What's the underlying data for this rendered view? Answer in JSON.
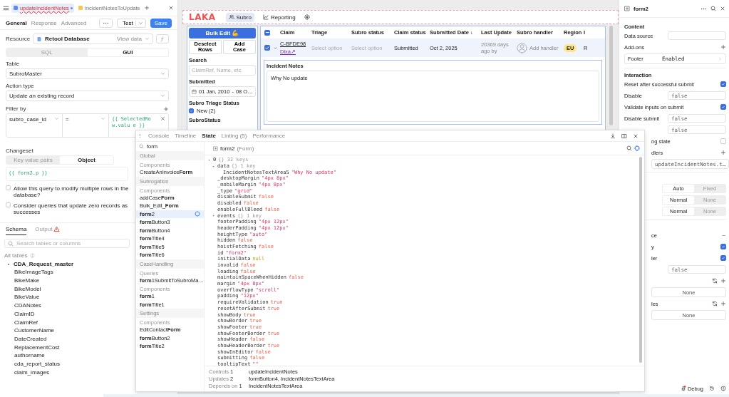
{
  "editor_tabs": [
    {
      "label": "updateIncidentNotes",
      "selected": true,
      "error": true,
      "unsaved": true
    },
    {
      "label": "IncidentNotesToUpdate",
      "selected": false,
      "error": false,
      "unsaved": false
    }
  ],
  "query_tabs": [
    {
      "label": "General",
      "selected": true
    },
    {
      "label": "Response",
      "selected": false
    },
    {
      "label": "Advanced",
      "selected": false
    }
  ],
  "test_button": "Test",
  "save_button": "Save",
  "resource": {
    "label": "Resource",
    "value": "Retool Database",
    "action": "View data"
  },
  "mode_toggle": [
    {
      "label": "SQL",
      "selected": false
    },
    {
      "label": "GUI",
      "selected": true
    }
  ],
  "table_select": {
    "label": "Table",
    "value": "SubroMaster"
  },
  "action_type": {
    "label": "Action type",
    "value": "Update an existing record"
  },
  "filter": {
    "label": "Filter by",
    "column": "subro_case_id",
    "operator": "=",
    "value": "{{ SelectedRow.valu e }}"
  },
  "changeset": {
    "label": "Changeset",
    "modes": [
      {
        "label": "Key value pairs",
        "selected": false
      },
      {
        "label": "Object",
        "selected": true
      }
    ],
    "code": "{{ form2.p }}"
  },
  "options": [
    {
      "label": "Allow this query to modify multiple rows in the database?",
      "checked": false
    },
    {
      "label": "Consider queries that update zero records as successes",
      "checked": false
    }
  ],
  "schema": {
    "tabs": [
      {
        "label": "Schema",
        "selected": true,
        "warning": false
      },
      {
        "label": "Output",
        "selected": false,
        "warning": true
      }
    ],
    "search_placeholder": "Search tables or columns",
    "all_tables": "All tables",
    "tree": [
      {
        "name": "CDA_Request_master",
        "expanded": true,
        "children": [
          {
            "name": "BikeImageTags"
          },
          {
            "name": "BikeMake"
          },
          {
            "name": "BikeModel"
          },
          {
            "name": "BikeValue"
          },
          {
            "name": "CDANotes"
          },
          {
            "name": "ClaimID"
          },
          {
            "name": "ClaimRef"
          },
          {
            "name": "CustomerName"
          },
          {
            "name": "DateCreated"
          },
          {
            "name": "ReplacementCost"
          },
          {
            "name": "authorname"
          },
          {
            "name": "cda_report_status"
          },
          {
            "name": "claim_images"
          }
        ]
      }
    ]
  },
  "app": {
    "logo": "LAKA",
    "nav": [
      {
        "label": "Subro",
        "selected": true
      },
      {
        "label": "Reporting",
        "selected": false
      }
    ],
    "filters": {
      "bulk_edit": "Bulk Edit 💪",
      "deselect": "Deselect Rows",
      "add_case": "Add Case",
      "search_label": "Search",
      "search_placeholder": "ClaimRef, Name, etc.",
      "submitted_label": "Submitted",
      "date_from": "01 Jan, 2010",
      "date_sep": "-",
      "date_to": "08 O…",
      "triage_label": "Subro Triage Status",
      "triage_options": [
        {
          "label": "New (2)",
          "checked": true
        }
      ],
      "status_label": "SubroStatus"
    },
    "grid": {
      "partial_selection": true,
      "columns": [
        "Claim",
        "Triage",
        "Subro status",
        "Claim status",
        "Submitted Date ↓",
        "Last Update",
        "Subro handler",
        "Region",
        "I"
      ],
      "rows": [
        {
          "selected": true,
          "expanded": true,
          "claim": "C-BFDE98",
          "link": "Dixa↗",
          "triage": "Select option",
          "subro_status": "Select option",
          "claim_status": "Submitted",
          "submitted_date": "Oct 2, 2025",
          "last_update": "20369 days ago by",
          "handler": "Add handler",
          "region": "EU",
          "column_9": "R"
        }
      ],
      "detail": {
        "label": "Incident Notes",
        "value": "Why No update"
      }
    }
  },
  "devtools": {
    "tabs": [
      {
        "label": "Console",
        "selected": false
      },
      {
        "label": "Timeline",
        "selected": false
      },
      {
        "label": "State",
        "selected": true
      },
      {
        "label": "Linting (5)",
        "selected": false
      },
      {
        "label": "Performance",
        "selected": false
      }
    ],
    "search": "form",
    "groups": [
      {
        "title": "Global",
        "sections": [
          {
            "title": "Components",
            "items": [
              {
                "label": "CreateAnInvoice**Form**",
                "selected": false
              }
            ]
          }
        ]
      },
      {
        "title": "Subrogation",
        "sections": [
          {
            "title": "Components",
            "items": [
              {
                "label": "addCase**Form**",
                "selected": false
              },
              {
                "label": "Bulk_Edit_**Form**",
                "selected": false
              },
              {
                "label": "**form**2",
                "selected": true
              },
              {
                "label": "**form**Button3",
                "selected": false
              },
              {
                "label": "**form**Button4",
                "selected": false
              },
              {
                "label": "**form**Title4",
                "selected": false
              },
              {
                "label": "**form**Title5",
                "selected": false
              },
              {
                "label": "**form**Title6",
                "selected": false
              }
            ]
          }
        ]
      },
      {
        "title": "CaseHandling",
        "sections": [
          {
            "title": "Queries",
            "items": [
              {
                "label": "**form**1SubmitToSubroMa…",
                "selected": false
              }
            ]
          },
          {
            "title": "Components",
            "items": [
              {
                "label": "**form**1",
                "selected": false
              },
              {
                "label": "**form**Title1",
                "selected": false
              }
            ]
          }
        ]
      },
      {
        "title": "Settings",
        "sections": [
          {
            "title": "Components",
            "items": [
              {
                "label": "EditContact**Form**",
                "selected": false
              },
              {
                "label": "**form**Button2",
                "selected": false
              },
              {
                "label": "**form**Title2",
                "selected": false
              }
            ]
          }
        ]
      }
    ],
    "inspector": {
      "title": "form2",
      "type": "(Form)",
      "lines": [
        {
          "key": "0",
          "value": "{} 32 keys",
          "kind": "object",
          "expanded": true,
          "children": [
            {
              "key": "data",
              "value": "{} 1 key",
              "kind": "object",
              "expanded": true,
              "children": [
                {
                  "key": "IncidentNotesTextArea5",
                  "value": "\"Why No update\"",
                  "kind": "string"
                }
              ]
            },
            {
              "key": "_desktopMargin",
              "value": "\"4px 8px\"",
              "kind": "string"
            },
            {
              "key": "_mobileMargin",
              "value": "\"4px 8px\"",
              "kind": "string"
            },
            {
              "key": "_type",
              "value": "\"grid\"",
              "kind": "string"
            },
            {
              "key": "disableSubmit",
              "value": "false",
              "kind": "boolean"
            },
            {
              "key": "disabled",
              "value": "false",
              "kind": "boolean"
            },
            {
              "key": "enableFullBleed",
              "value": "false",
              "kind": "boolean"
            },
            {
              "key": "events",
              "value": "{} 1 key",
              "kind": "object",
              "expanded": false
            },
            {
              "key": "footerPadding",
              "value": "\"4px 12px\"",
              "kind": "string"
            },
            {
              "key": "headerPadding",
              "value": "\"4px 12px\"",
              "kind": "string"
            },
            {
              "key": "heightType",
              "value": "\"auto\"",
              "kind": "string"
            },
            {
              "key": "hidden",
              "value": "false",
              "kind": "boolean"
            },
            {
              "key": "hoistFetching",
              "value": "false",
              "kind": "boolean"
            },
            {
              "key": "id",
              "value": "\"form2\"",
              "kind": "string"
            },
            {
              "key": "initialData",
              "value": "null",
              "kind": "null"
            },
            {
              "key": "invalid",
              "value": "false",
              "kind": "boolean"
            },
            {
              "key": "loading",
              "value": "false",
              "kind": "boolean"
            },
            {
              "key": "maintainSpaceWhenHidden",
              "value": "false",
              "kind": "boolean"
            },
            {
              "key": "margin",
              "value": "\"4px 8px\"",
              "kind": "string"
            },
            {
              "key": "overflowType",
              "value": "\"scroll\"",
              "kind": "string"
            },
            {
              "key": "padding",
              "value": "\"12px\"",
              "kind": "string"
            },
            {
              "key": "requireValidation",
              "value": "true",
              "kind": "boolean"
            },
            {
              "key": "resetAfterSubmit",
              "value": "true",
              "kind": "boolean"
            },
            {
              "key": "showBody",
              "value": "true",
              "kind": "boolean"
            },
            {
              "key": "showBorder",
              "value": "true",
              "kind": "boolean"
            },
            {
              "key": "showFooter",
              "value": "true",
              "kind": "boolean"
            },
            {
              "key": "showFooterBorder",
              "value": "true",
              "kind": "boolean"
            },
            {
              "key": "showHeader",
              "value": "false",
              "kind": "boolean"
            },
            {
              "key": "showHeaderBorder",
              "value": "true",
              "kind": "boolean"
            },
            {
              "key": "showInEditor",
              "value": "false",
              "kind": "boolean"
            },
            {
              "key": "submitting",
              "value": "false",
              "kind": "boolean"
            },
            {
              "key": "tooltipText",
              "value": "\"\"",
              "kind": "string"
            }
          ]
        }
      ]
    },
    "footer": [
      {
        "label": "Controls",
        "count": "1",
        "value": "updateIncidentNotes"
      },
      {
        "label": "Updates",
        "count": "2",
        "value": "formButton4, IncidentNotesTextArea"
      },
      {
        "label": "Depends on",
        "count": "1",
        "value": "IncidentNotesTextArea"
      }
    ]
  },
  "properties": {
    "title": "form2",
    "rows": [
      {
        "kind": "section",
        "label": "Content"
      },
      {
        "kind": "field",
        "label": "Data source"
      },
      {
        "kind": "header",
        "label": "Add-ons"
      },
      {
        "kind": "item",
        "label": "Footer",
        "value": "Enabled"
      },
      {
        "kind": "section",
        "label": "Interaction"
      },
      {
        "kind": "checkbox",
        "label": "Reset after successful submit",
        "checked": true
      },
      {
        "kind": "field",
        "label": "Disable",
        "value": "false"
      },
      {
        "kind": "checkbox",
        "label": "Validate inputs on submit",
        "checked": true
      },
      {
        "kind": "field",
        "label": "Disable submit",
        "value": "false"
      },
      {
        "kind": "field",
        "value": "false"
      },
      {
        "kind": "checkbox",
        "label": "ng state",
        "checked": false
      },
      {
        "kind": "header",
        "label": "dlers"
      },
      {
        "kind": "wide",
        "value": "updateIncidentNotes.t…"
      },
      {
        "kind": "section"
      },
      {
        "kind": "segmented",
        "options": [
          {
            "label": "Auto",
            "selected": true
          },
          {
            "label": "Fixed",
            "selected": false
          }
        ]
      },
      {
        "kind": "segmented",
        "options": [
          {
            "label": "Normal",
            "selected": true
          },
          {
            "label": "None",
            "selected": false
          }
        ]
      },
      {
        "kind": "segmented",
        "options": [
          {
            "label": "Normal",
            "selected": true
          },
          {
            "label": "None",
            "selected": false
          }
        ]
      },
      {
        "kind": "section"
      },
      {
        "kind": "more",
        "label": "ce"
      },
      {
        "kind": "checkbox",
        "label": "y",
        "checked": true
      },
      {
        "kind": "checkbox",
        "label": "ler",
        "checked": true
      },
      {
        "kind": "field",
        "value": "false"
      },
      {
        "kind": "actions"
      },
      {
        "kind": "wide",
        "value": "None"
      },
      {
        "kind": "actions",
        "label": "les"
      },
      {
        "kind": "wide",
        "value": "None"
      }
    ],
    "debug": "Debug"
  }
}
